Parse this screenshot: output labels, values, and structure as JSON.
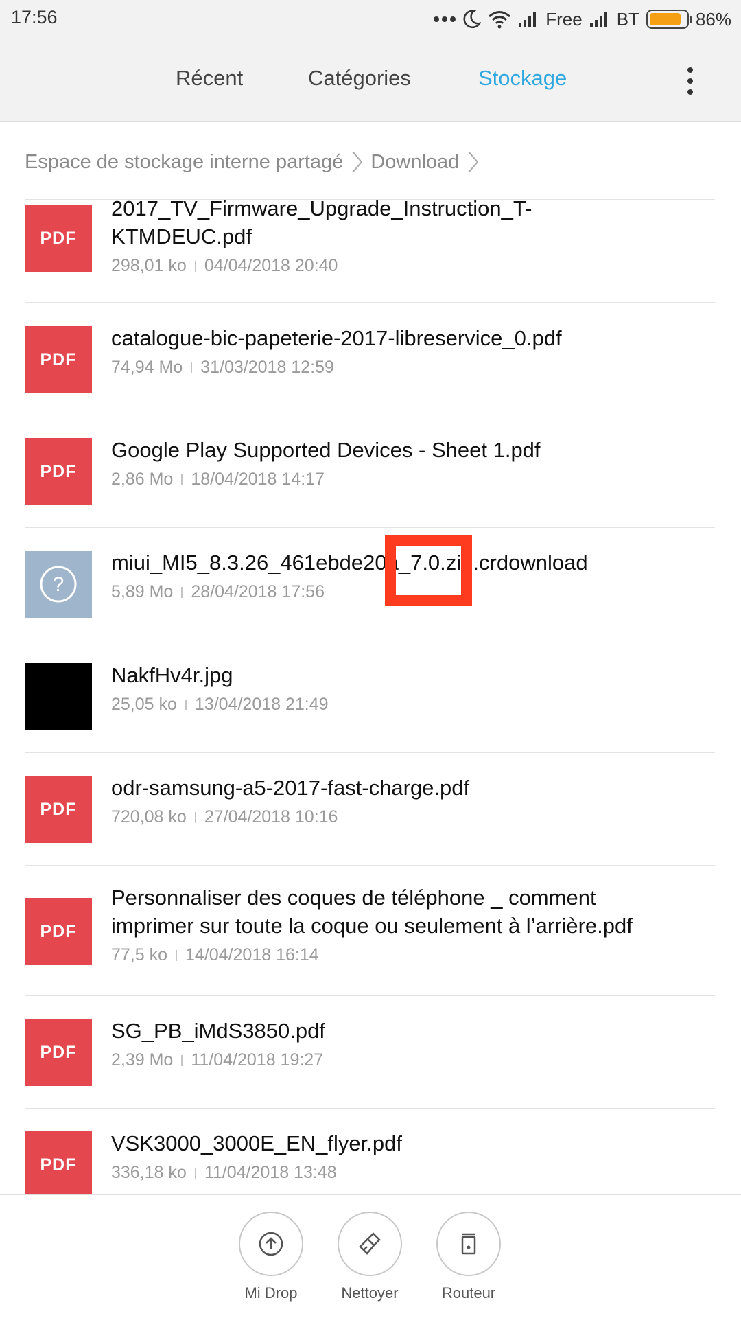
{
  "status_bar": {
    "time": "17:56",
    "carrier1": "Free",
    "carrier2": "BT",
    "battery_percent": "86%",
    "battery_level": 0.86,
    "battery_color": "#f5a014",
    "icons": [
      "more-dots-icon",
      "moon-icon",
      "wifi-icon",
      "signal-icon",
      "signal-icon",
      "battery-icon"
    ]
  },
  "header": {
    "tabs": [
      {
        "label": "Récent",
        "active": false
      },
      {
        "label": "Catégories",
        "active": false
      },
      {
        "label": "Stockage",
        "active": true
      }
    ],
    "active_color": "#2fa8e0",
    "menu_icon": "overflow-menu-icon"
  },
  "breadcrumb": {
    "items": [
      "Espace de stockage interne partagé",
      "Download"
    ]
  },
  "files": [
    {
      "name": "2017_TV_Firmware_Upgrade_Instruction_T-KTMDEUC.pdf",
      "name_line1": "2017_TV_Firmware_Upgrade_Instruction_T-",
      "name_line2": "KTMDEUC.pdf",
      "size": "298,01 ko",
      "date": "04/04/2018 20:40",
      "type": "pdf",
      "icon_label": "PDF"
    },
    {
      "name": "catalogue-bic-papeterie-2017-libreservice_0.pdf",
      "size": "74,94 Mo",
      "date": "31/03/2018 12:59",
      "type": "pdf",
      "icon_label": "PDF"
    },
    {
      "name": "Google Play Supported Devices - Sheet 1.pdf",
      "size": "2,86 Mo",
      "date": "18/04/2018 14:17",
      "type": "pdf",
      "icon_label": "PDF"
    },
    {
      "name": "miui_MI5_8.3.26_461ebde20a_7.0.zip.crdownload",
      "size": "5,89 Mo",
      "date": "28/04/2018 17:56",
      "type": "unknown",
      "icon_label": "?"
    },
    {
      "name": "NakfHv4r.jpg",
      "size": "25,05 ko",
      "date": "13/04/2018 21:49",
      "type": "image"
    },
    {
      "name": "odr-samsung-a5-2017-fast-charge.pdf",
      "size": "720,08 ko",
      "date": "27/04/2018 10:16",
      "type": "pdf",
      "icon_label": "PDF"
    },
    {
      "name": "Personnaliser des coques de téléphone _ comment imprimer sur toute la coque ou seulement à l’arrière.pdf",
      "name_line1": "Personnaliser des coques de téléphone _ comment",
      "name_line2": "imprimer sur toute la coque ou seulement à l’arrière.pdf",
      "size": "77,5 ko",
      "date": "14/04/2018 16:14",
      "type": "pdf",
      "icon_label": "PDF"
    },
    {
      "name": "SG_PB_iMdS3850.pdf",
      "size": "2,39 Mo",
      "date": "11/04/2018 19:27",
      "type": "pdf",
      "icon_label": "PDF"
    },
    {
      "name": "VSK3000_3000E_EN_flyer.pdf",
      "size": "336,18 ko",
      "date": "11/04/2018 13:48",
      "type": "pdf",
      "icon_label": "PDF"
    }
  ],
  "highlight_color": "#ff3b1f",
  "bottom_bar": {
    "buttons": [
      {
        "label": "Mi Drop",
        "icon": "mi-drop-icon"
      },
      {
        "label": "Nettoyer",
        "icon": "broom-icon"
      },
      {
        "label": "Routeur",
        "icon": "router-icon"
      }
    ]
  }
}
